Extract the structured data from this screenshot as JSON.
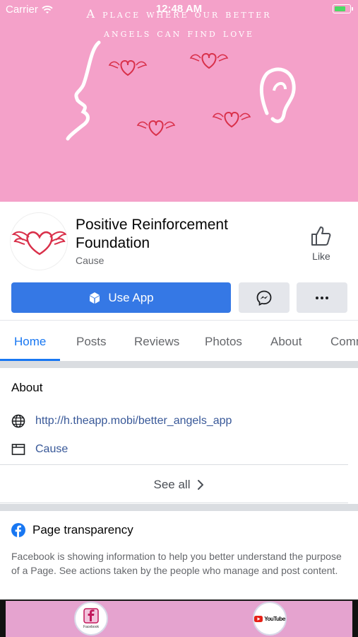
{
  "status_bar": {
    "carrier": "Carrier",
    "time": "12:48 AM",
    "battery_level": 0.75
  },
  "cover": {
    "tagline_line1": "A place where our better",
    "tagline_line2": "angels can find love",
    "background_color": "#f4a1c9"
  },
  "page": {
    "name": "Positive Reinforcement Foundation",
    "category": "Cause",
    "like_label": "Like"
  },
  "actions": {
    "use_app_label": "Use App",
    "messenger_icon": "messenger-icon",
    "more_icon": "more-icon"
  },
  "tabs": [
    {
      "label": "Home",
      "active": true
    },
    {
      "label": "Posts"
    },
    {
      "label": "Reviews"
    },
    {
      "label": "Photos"
    },
    {
      "label": "About"
    },
    {
      "label": "Comm"
    }
  ],
  "about": {
    "title": "About",
    "website": "http://h.theapp.mobi/better_angels_app",
    "category": "Cause",
    "see_all": "See all"
  },
  "transparency": {
    "title": "Page transparency",
    "body": "Facebook is showing information to help you better understand the purpose of a Page. See actions taken by the people who manage and post content."
  },
  "dock": {
    "facebook_label": "Facebook",
    "youtube_label": "YouTube"
  },
  "colors": {
    "accent": "#1877f2",
    "button_blue": "#3578e5",
    "link": "#385898",
    "dock_bg": "#e5a3cf"
  }
}
